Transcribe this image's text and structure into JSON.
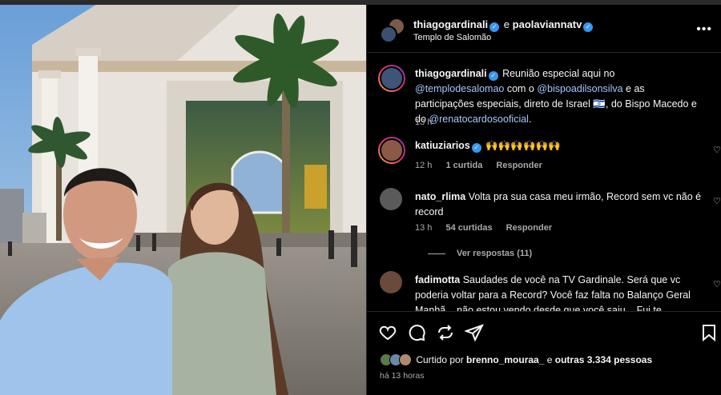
{
  "post": {
    "author": "thiagogardinali",
    "conjunction": "e",
    "collaborator": "paolaviannatv",
    "location": "Templo de Salomão"
  },
  "caption": {
    "username": "thiagogardinali",
    "text_1": " Reunião especial aqui no ",
    "mention_1": "@templodesalomao",
    "text_2": " com o ",
    "mention_2": "@bispoadilsonsilva",
    "text_3": " e as participações especiais, direto de Israel 🇮🇱, do Bispo Macedo e do ",
    "mention_3": "@renatocardosooficial",
    "text_4": ".",
    "time": "13 h"
  },
  "comments": [
    {
      "username": "katiuziarios",
      "text": " 🙌🙌🙌🙌🙌🙌",
      "time": "12 h",
      "likes": "1 curtida",
      "reply": "Responder"
    },
    {
      "username": "nato_rlima",
      "text": " Volta pra sua casa meu irmão, Record sem vc não é record",
      "time": "13 h",
      "likes": "54 curtidas",
      "reply": "Responder",
      "view_replies": "Ver respostas (11)"
    },
    {
      "username": "fadimotta",
      "text": " Saudades de você na TV Gardinale. Será que vc poderia voltar para a Record? Você faz falta no Balanço Geral Manhã... não estou vendo desde que você saiu... Fui te"
    }
  ],
  "footer": {
    "liked_prefix": "Curtido por ",
    "liked_user": "brenno_mouraa_",
    "liked_middle": " e ",
    "liked_others": "outras 3.334 pessoas",
    "time": "há 13 horas"
  },
  "colors": {
    "background": "#000000",
    "verified": "#3797f0",
    "secondary_text": "#a8a8a8",
    "mention": "#a5c8ff"
  },
  "icons": [
    "more-icon",
    "verified-icon",
    "heart-icon",
    "comment-icon",
    "share-icon",
    "send-icon",
    "bookmark-icon"
  ]
}
